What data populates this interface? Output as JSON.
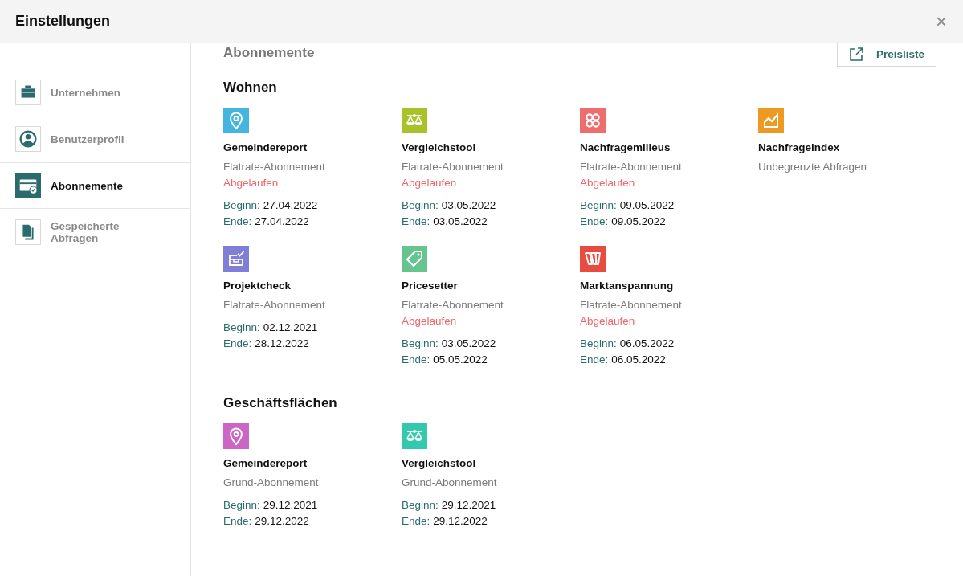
{
  "window": {
    "title": "Einstellungen",
    "close": "×"
  },
  "sidebar": {
    "items": [
      {
        "label": "Unternehmen",
        "kind": "briefcase",
        "selected": false
      },
      {
        "label": "Benutzerprofil",
        "kind": "user",
        "selected": false
      },
      {
        "label": "Abonnemente",
        "kind": "card",
        "selected": true
      },
      {
        "label": "Gespeicherte Abfragen",
        "kind": "documents",
        "selected": false
      }
    ]
  },
  "content": {
    "heading": "Abonnemente",
    "price_button": "Preisliste",
    "sections": [
      {
        "title": "Wohnen",
        "products": [
          {
            "name": "Gemeindereport",
            "kind": "pin",
            "color": "#45b5e0",
            "plan": "Flatrate-Abonnement",
            "status": "Abgelaufen",
            "begin_label": "Beginn:",
            "begin": "27.04.2022",
            "end_label": "Ende:",
            "end": "27.04.2022"
          },
          {
            "name": "Vergleichstool",
            "kind": "scale",
            "color": "#a9c22a",
            "plan": "Flatrate-Abonnement",
            "status": "Abgelaufen",
            "begin_label": "Beginn:",
            "begin": "03.05.2022",
            "end_label": "Ende:",
            "end": "03.05.2022"
          },
          {
            "name": "Nachfragemilieus",
            "kind": "clover",
            "color": "#ee6e6e",
            "plan": "Flatrate-Abonnement",
            "status": "Abgelaufen",
            "begin_label": "Beginn:",
            "begin": "09.05.2022",
            "end_label": "Ende:",
            "end": "09.05.2022"
          },
          {
            "name": "Nachfrageindex",
            "kind": "chart",
            "color": "#ec9a22",
            "plan": "Unbegrenzte Abfragen"
          },
          {
            "name": "Projektcheck",
            "kind": "checkbox",
            "color": "#7f7fd8",
            "plan": "Flatrate-Abonnement",
            "begin_label": "Beginn:",
            "begin": "02.12.2021",
            "end_label": "Ende:",
            "end": "28.12.2022"
          },
          {
            "name": "Pricesetter",
            "kind": "tag",
            "color": "#66c48e",
            "plan": "Flatrate-Abonnement",
            "status": "Abgelaufen",
            "begin_label": "Beginn:",
            "begin": "03.05.2022",
            "end_label": "Ende:",
            "end": "05.05.2022"
          },
          {
            "name": "Marktanspannung",
            "kind": "bars",
            "color": "#e84c3f",
            "plan": "Flatrate-Abonnement",
            "status": "Abgelaufen",
            "begin_label": "Beginn:",
            "begin": "06.05.2022",
            "end_label": "Ende:",
            "end": "06.05.2022"
          }
        ]
      },
      {
        "title": "Geschäftsflächen",
        "products": [
          {
            "name": "Gemeindereport",
            "kind": "pin",
            "color": "#cc66c4",
            "plan": "Grund-Abonnement",
            "begin_label": "Beginn:",
            "begin": "29.12.2021",
            "end_label": "Ende:",
            "end": "29.12.2022"
          },
          {
            "name": "Vergleichstool",
            "kind": "scale",
            "color": "#33c9ad",
            "plan": "Grund-Abonnement",
            "begin_label": "Beginn:",
            "begin": "29.12.2021",
            "end_label": "Ende:",
            "end": "29.12.2022"
          }
        ]
      }
    ]
  }
}
